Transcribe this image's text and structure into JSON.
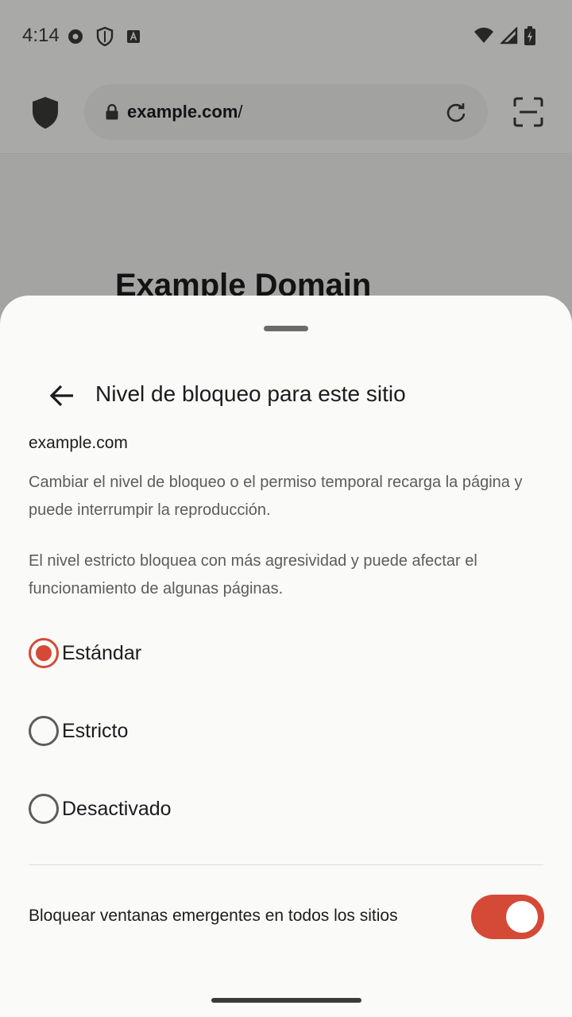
{
  "status_bar": {
    "time": "4:14",
    "left_icons": [
      "sync-icon",
      "vpn-shield-icon",
      "keyboard-a-icon"
    ],
    "right_icons": [
      "wifi-icon",
      "cellular-icon",
      "battery-charging-icon"
    ]
  },
  "toolbar": {
    "url_domain": "example.com",
    "url_path": "/",
    "icons": [
      "tracking-shield-icon",
      "lock-icon",
      "reload-icon",
      "scan-icon"
    ]
  },
  "web_page": {
    "title": "Example Domain"
  },
  "sheet": {
    "title": "Nivel de bloqueo para este sitio",
    "site": "example.com",
    "description_1": "Cambiar el nivel de bloqueo o el permiso temporal recarga la página y puede interrumpir la reproducción.",
    "description_2": "El nivel estricto bloquea con más agresividad y puede afectar el funcionamiento de algunas páginas.",
    "options": [
      {
        "label": "Estándar",
        "selected": true
      },
      {
        "label": "Estricto",
        "selected": false
      },
      {
        "label": "Desactivado",
        "selected": false
      }
    ],
    "popup_toggle_label": "Bloquear ventanas emergentes en todos los sitios",
    "popup_toggle_on": true
  },
  "colors": {
    "accent": "#d44a36",
    "sheet_background": "#fafaf8",
    "text_primary": "#1c1b1f",
    "text_secondary": "#5c5c5c"
  }
}
